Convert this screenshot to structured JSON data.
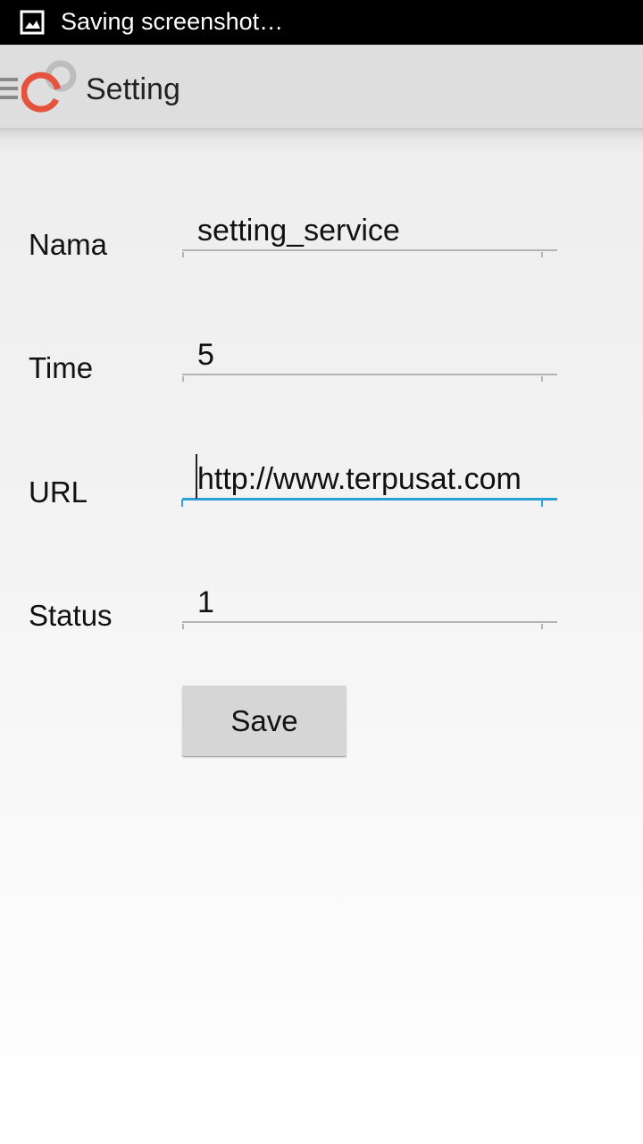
{
  "status_bar": {
    "notification_icon": "image-icon",
    "text": "Saving screenshot…"
  },
  "action_bar": {
    "title": "Setting",
    "drawer_icon": "hamburger-menu-icon",
    "logo_icon": "app-logo-rings-icon"
  },
  "form": {
    "fields": [
      {
        "label": "Nama",
        "value": "setting_service",
        "focused": false
      },
      {
        "label": "Time",
        "value": "5",
        "focused": false
      },
      {
        "label": "URL",
        "value": "http://www.terpusat.com",
        "focused": true
      },
      {
        "label": "Status",
        "value": "1",
        "focused": false
      }
    ],
    "save_label": "Save"
  },
  "colors": {
    "status_bar": "#000000",
    "action_bar": "#dedede",
    "focus_accent": "#2a9fd8",
    "logo_red": "#e5533f",
    "logo_gray": "#bdbdbd"
  }
}
